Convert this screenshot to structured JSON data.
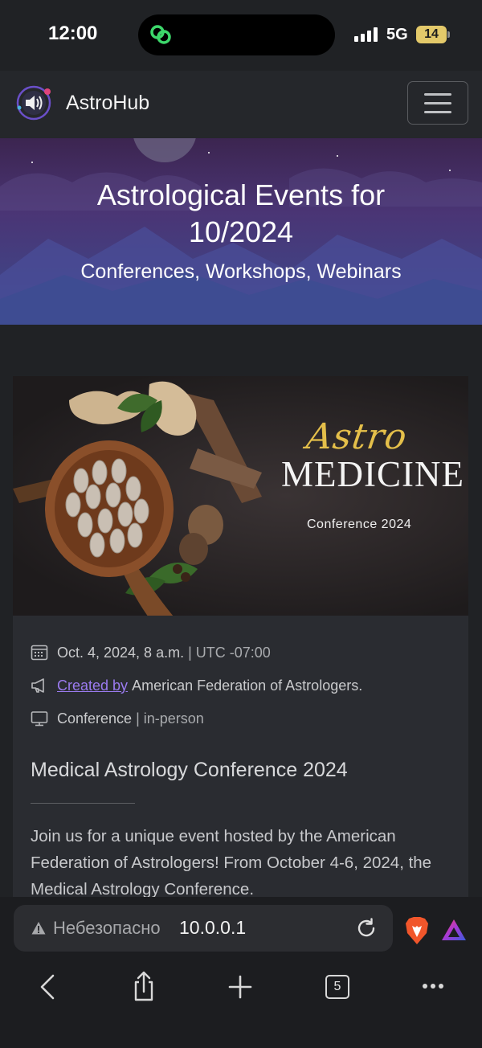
{
  "status_bar": {
    "time": "12:00",
    "network": "5G",
    "battery": "14"
  },
  "navbar": {
    "brand": "AstroHub"
  },
  "hero": {
    "title": "Astrological Events for 10/2024",
    "subtitle": "Conferences, Workshops, Webinars"
  },
  "event": {
    "banner": {
      "line1": "Astro",
      "line2": "MEDICINE",
      "line3": "Conference 2024"
    },
    "date": "Oct. 4, 2024, 8 a.m.",
    "timezone": "| UTC -07:00",
    "created_by_label": "Created by",
    "organizer": "American Federation of Astrologers.",
    "type": "Conference",
    "mode": "| in-person",
    "title": "Medical Astrology Conference 2024",
    "description": "Join us for a unique event hosted by the American Federation of Astrologers! From October 4-6, 2024, the Medical Astrology Conference."
  },
  "browser": {
    "security_label": "Небезопасно",
    "url": "10.0.0.1",
    "tab_count": "5"
  },
  "colors": {
    "accent_link": "#9b7bf0",
    "gold": "#e4bf4a",
    "brave": "#f1562b"
  }
}
